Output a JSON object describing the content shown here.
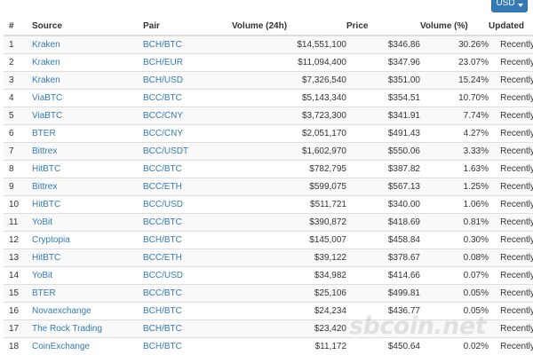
{
  "currency_selector": {
    "label": "USD"
  },
  "table": {
    "headers": {
      "rank": "#",
      "source": "Source",
      "pair": "Pair",
      "volume": "Volume (24h)",
      "price": "Price",
      "volume_pct": "Volume (%)",
      "updated": "Updated"
    },
    "rows": [
      {
        "rank": "1",
        "source": "Kraken",
        "pair": "BCH/BTC",
        "volume": "$14,551,100",
        "price": "$346.86",
        "volume_pct": "30.26%",
        "updated": "Recently"
      },
      {
        "rank": "2",
        "source": "Kraken",
        "pair": "BCH/EUR",
        "volume": "$11,094,400",
        "price": "$347.96",
        "volume_pct": "23.07%",
        "updated": "Recently"
      },
      {
        "rank": "3",
        "source": "Kraken",
        "pair": "BCH/USD",
        "volume": "$7,326,540",
        "price": "$351.00",
        "volume_pct": "15.24%",
        "updated": "Recently"
      },
      {
        "rank": "4",
        "source": "ViaBTC",
        "pair": "BCC/BTC",
        "volume": "$5,143,340",
        "price": "$354.51",
        "volume_pct": "10.70%",
        "updated": "Recently"
      },
      {
        "rank": "5",
        "source": "ViaBTC",
        "pair": "BCC/CNY",
        "volume": "$3,723,300",
        "price": "$341.91",
        "volume_pct": "7.74%",
        "updated": "Recently"
      },
      {
        "rank": "6",
        "source": "BTER",
        "pair": "BCC/CNY",
        "volume": "$2,051,170",
        "price": "$491.43",
        "volume_pct": "4.27%",
        "updated": "Recently"
      },
      {
        "rank": "7",
        "source": "Bittrex",
        "pair": "BCC/USDT",
        "volume": "$1,602,970",
        "price": "$550.06",
        "volume_pct": "3.33%",
        "updated": "Recently"
      },
      {
        "rank": "8",
        "source": "HitBTC",
        "pair": "BCC/BTC",
        "volume": "$782,795",
        "price": "$387.82",
        "volume_pct": "1.63%",
        "updated": "Recently"
      },
      {
        "rank": "9",
        "source": "Bittrex",
        "pair": "BCC/ETH",
        "volume": "$599,075",
        "price": "$567.13",
        "volume_pct": "1.25%",
        "updated": "Recently"
      },
      {
        "rank": "10",
        "source": "HitBTC",
        "pair": "BCC/USD",
        "volume": "$511,721",
        "price": "$340.00",
        "volume_pct": "1.06%",
        "updated": "Recently"
      },
      {
        "rank": "11",
        "source": "YoBit",
        "pair": "BCC/BTC",
        "volume": "$390,872",
        "price": "$418.69",
        "volume_pct": "0.81%",
        "updated": "Recently"
      },
      {
        "rank": "12",
        "source": "Cryptopia",
        "pair": "BCH/BTC",
        "volume": "$145,007",
        "price": "$458.84",
        "volume_pct": "0.30%",
        "updated": "Recently"
      },
      {
        "rank": "13",
        "source": "HitBTC",
        "pair": "BCC/ETH",
        "volume": "$39,122",
        "price": "$378.67",
        "volume_pct": "0.08%",
        "updated": "Recently"
      },
      {
        "rank": "14",
        "source": "YoBit",
        "pair": "BCC/USD",
        "volume": "$34,982",
        "price": "$414.66",
        "volume_pct": "0.07%",
        "updated": "Recently"
      },
      {
        "rank": "15",
        "source": "BTER",
        "pair": "BCC/BTC",
        "volume": "$25,106",
        "price": "$499.81",
        "volume_pct": "0.05%",
        "updated": "Recently"
      },
      {
        "rank": "16",
        "source": "Novaexchange",
        "pair": "BCH/BTC",
        "volume": "$24,234",
        "price": "$436.77",
        "volume_pct": "0.05%",
        "updated": "Recently"
      },
      {
        "rank": "17",
        "source": "The Rock Trading",
        "pair": "BCH/BTC",
        "volume": "$23,420",
        "price": "",
        "volume_pct": "",
        "updated": "Recently"
      },
      {
        "rank": "18",
        "source": "CoinExchange",
        "pair": "BCH/BTC",
        "volume": "$11,172",
        "price": "$450.64",
        "volume_pct": "0.02%",
        "updated": "Recently"
      }
    ]
  },
  "watermark": "sbcoin.net",
  "colors": {
    "link": "#337ab7",
    "button": "#337ab7",
    "stripe": "#f9f9f9",
    "border": "#dddddd"
  }
}
